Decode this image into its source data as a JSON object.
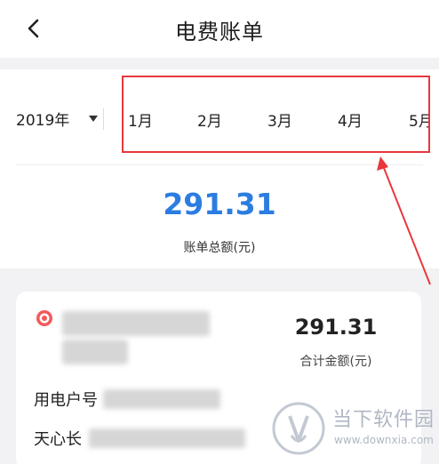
{
  "header": {
    "title": "电费账单",
    "back_icon": "chevron-left-icon"
  },
  "selector": {
    "year": "2019年",
    "months": [
      "1月",
      "2月",
      "3月",
      "4月",
      "5月"
    ]
  },
  "summary": {
    "total_amount": "291.31",
    "total_label": "账单总额(元)"
  },
  "card": {
    "amount": "291.31",
    "amount_label": "合计金额(元)",
    "account_label": "用电户号",
    "address_label": "天心长"
  },
  "watermark": {
    "text": "当下软件园",
    "url": "www.downxia.com"
  },
  "colors": {
    "accent_blue": "#2b7de1",
    "highlight_red": "#e8383d"
  }
}
